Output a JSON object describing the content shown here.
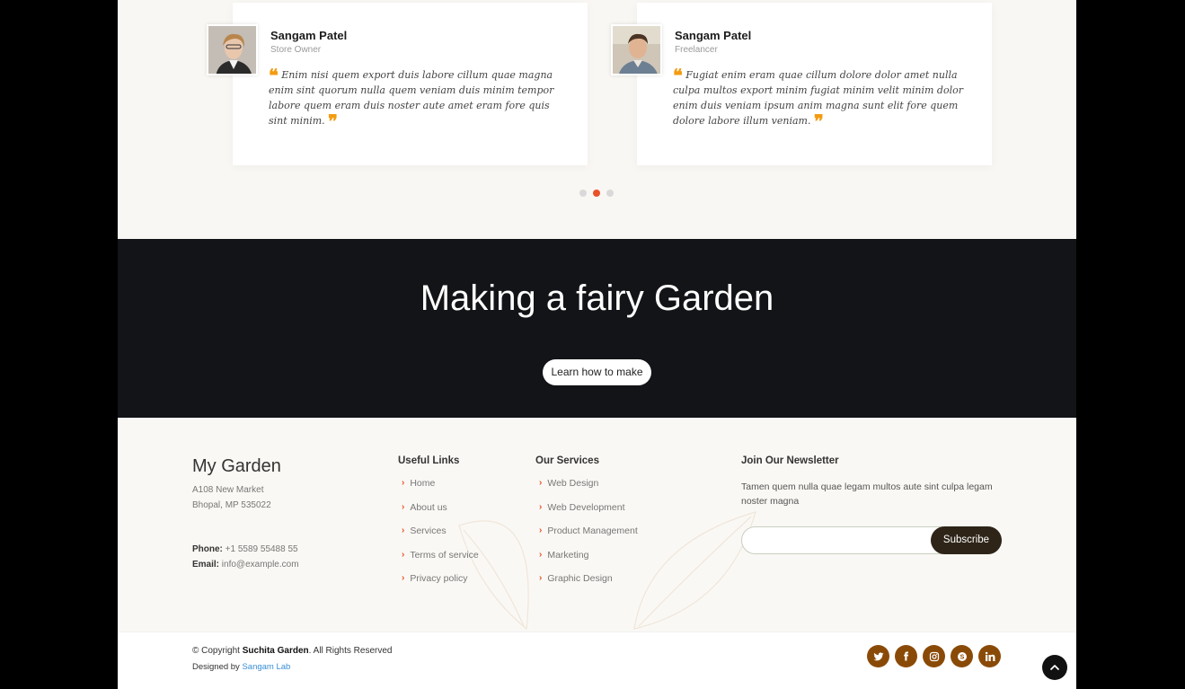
{
  "testimonials": [
    {
      "name": "Sangam Patel",
      "role": "Store Owner",
      "quote": "Enim nisi quem export duis labore cillum quae magna enim sint quorum nulla quem veniam duis minim tempor labore quem eram duis noster aute amet eram fore quis sint minim."
    },
    {
      "name": "Sangam Patel",
      "role": "Freelancer",
      "quote": "Fugiat enim eram quae cillum dolore dolor amet nulla culpa multos export minim fugiat minim velit minim dolor enim duis veniam ipsum anim magna sunt elit fore quem dolore labore illum veniam."
    }
  ],
  "carousel": {
    "dots": 3,
    "active": 1
  },
  "banner": {
    "title": "Making a fairy Garden",
    "button_label": "Learn how to make"
  },
  "footer": {
    "brand": "My Garden",
    "address_line1": "A108 New Market",
    "address_line2": "Bhopal, MP 535022",
    "phone_label": "Phone:",
    "phone": "+1 5589 55488 55",
    "email_label": "Email:",
    "email": "info@example.com",
    "useful_links_title": "Useful Links",
    "useful_links": [
      "Home",
      "About us",
      "Services",
      "Terms of service",
      "Privacy policy"
    ],
    "services_title": "Our Services",
    "services": [
      "Web Design",
      "Web Development",
      "Product Management",
      "Marketing",
      "Graphic Design"
    ],
    "newsletter_title": "Join Our Newsletter",
    "newsletter_text": "Tamen quem nulla quae legam multos aute sint culpa legam noster magna",
    "newsletter_input_value": "",
    "subscribe_label": "Subscribe"
  },
  "bottom": {
    "copyright_prefix": "© Copyright",
    "copyright_name": "Suchita Garden",
    "copyright_suffix": ". All Rights Reserved",
    "designed_prefix": "Designed by",
    "designed_link": "Sangam Lab",
    "socials": [
      {
        "name": "twitter-icon",
        "glyph": "t"
      },
      {
        "name": "facebook-icon",
        "glyph": "f"
      },
      {
        "name": "instagram-icon",
        "glyph": "◎"
      },
      {
        "name": "skype-icon",
        "glyph": "S"
      },
      {
        "name": "linkedin-icon",
        "glyph": "in"
      }
    ]
  },
  "colors": {
    "accent": "#e8522b",
    "quote_mark": "#f39c12",
    "social_bg": "#8a4a07",
    "subscribe_bg": "#2e2418",
    "link": "#3a8fd8"
  }
}
